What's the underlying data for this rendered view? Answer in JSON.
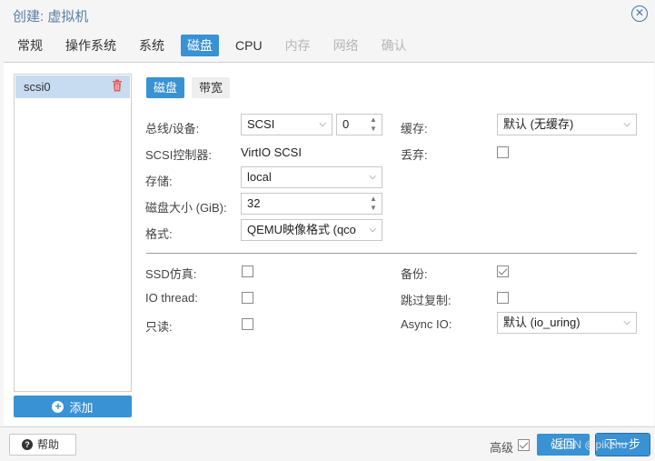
{
  "window": {
    "title": "创建: 虚拟机"
  },
  "tabs": [
    {
      "label": "常规",
      "state": "normal"
    },
    {
      "label": "操作系统",
      "state": "normal"
    },
    {
      "label": "系统",
      "state": "normal"
    },
    {
      "label": "磁盘",
      "state": "active"
    },
    {
      "label": "CPU",
      "state": "normal"
    },
    {
      "label": "内存",
      "state": "disabled"
    },
    {
      "label": "网络",
      "state": "disabled"
    },
    {
      "label": "确认",
      "state": "disabled"
    }
  ],
  "disks": {
    "items": [
      {
        "label": "scsi0"
      }
    ],
    "add_label": "添加"
  },
  "subtabs": [
    {
      "label": "磁盘"
    },
    {
      "label": "带宽"
    }
  ],
  "form": {
    "bus_label": "总线/设备:",
    "bus_value": "SCSI",
    "device_value": "0",
    "controller_label": "SCSI控制器:",
    "controller_value": "VirtIO SCSI",
    "storage_label": "存储:",
    "storage_value": "local",
    "size_label": "磁盘大小 (GiB):",
    "size_value": "32",
    "format_label": "格式:",
    "format_value": "QEMU映像格式 (qco",
    "cache_label": "缓存:",
    "cache_value": "默认 (无缓存)",
    "discard_label": "丢弃:",
    "discard_checked": false,
    "ssd_label": "SSD仿真:",
    "ssd_checked": false,
    "iothread_label": "IO thread:",
    "iothread_checked": false,
    "readonly_label": "只读:",
    "readonly_checked": false,
    "backup_label": "备份:",
    "backup_checked": true,
    "skip_label": "跳过复制:",
    "skip_checked": false,
    "asyncio_label": "Async IO:",
    "asyncio_value": "默认 (io_uring)"
  },
  "footer": {
    "help_label": "帮助",
    "advanced_label": "高级",
    "advanced_checked": true,
    "back_label": "返回",
    "next_label": "下一步",
    "watermark": "CSDN @pikzhu"
  },
  "colors": {
    "accent": "#3892d4",
    "selected_row": "#c7dcf0",
    "delete": "#e05b5b"
  }
}
